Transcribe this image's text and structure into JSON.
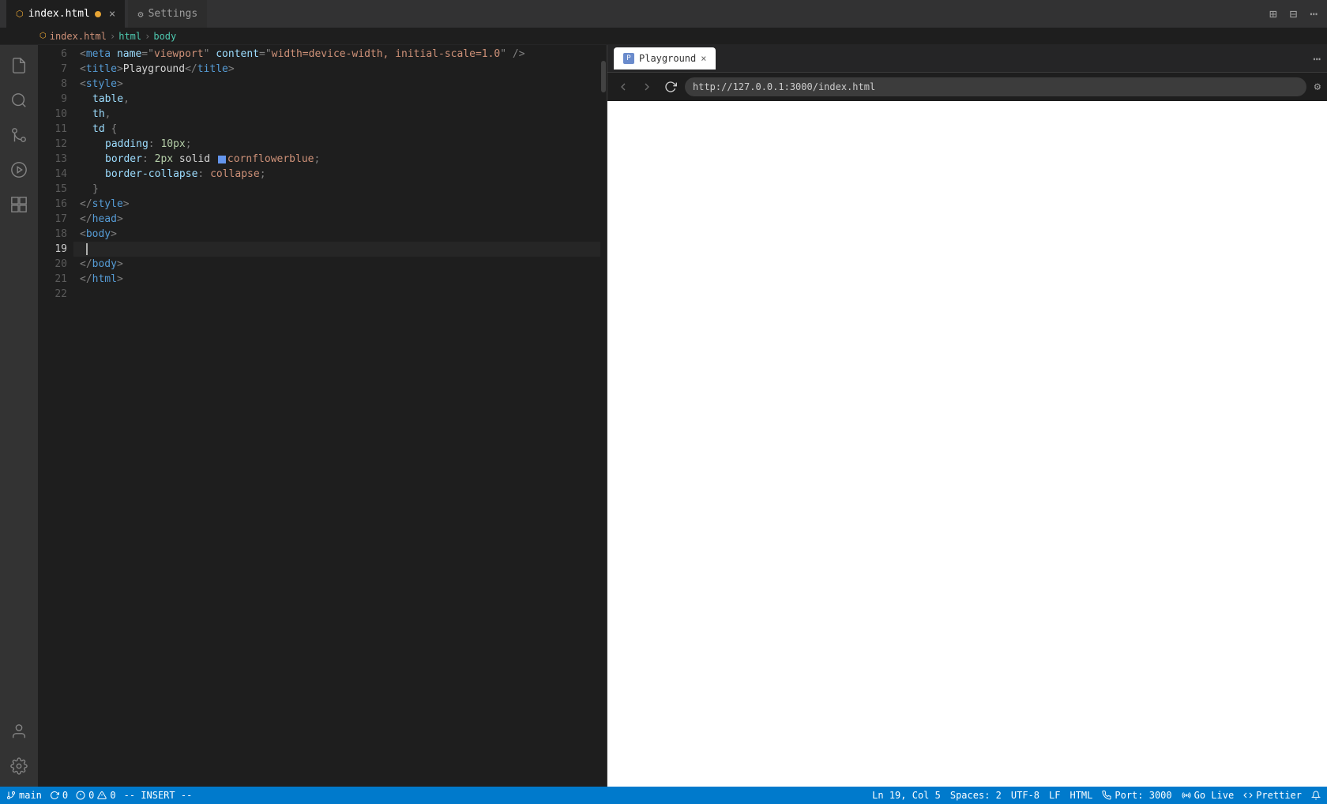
{
  "titleBar": {
    "tabs": [
      {
        "id": "index-html",
        "label": "index.html",
        "active": true,
        "modified": true
      },
      {
        "id": "settings",
        "label": "Settings",
        "active": false,
        "modified": false
      }
    ],
    "icons": [
      "split-editor-icon",
      "editor-layout-icon",
      "more-icon"
    ]
  },
  "breadcrumb": {
    "items": [
      "index.html",
      "html",
      "body"
    ]
  },
  "editor": {
    "lines": [
      {
        "num": 6,
        "content": "meta_viewport"
      },
      {
        "num": 7,
        "content": "title"
      },
      {
        "num": 8,
        "content": "style_open"
      },
      {
        "num": 9,
        "content": "table_comma"
      },
      {
        "num": 10,
        "content": "th_comma"
      },
      {
        "num": 11,
        "content": "td_brace"
      },
      {
        "num": 12,
        "content": "padding"
      },
      {
        "num": 13,
        "content": "border"
      },
      {
        "num": 14,
        "content": "border_collapse"
      },
      {
        "num": 15,
        "content": "brace_close"
      },
      {
        "num": 16,
        "content": "style_close"
      },
      {
        "num": 17,
        "content": "head_close"
      },
      {
        "num": 18,
        "content": "body_open"
      },
      {
        "num": 19,
        "content": "cursor_line",
        "active": true
      },
      {
        "num": 20,
        "content": "body_close"
      },
      {
        "num": 21,
        "content": "html_close"
      },
      {
        "num": 22,
        "content": "empty"
      }
    ],
    "activeLine": 19,
    "cursorPos": "Ln 19, Col 5",
    "spaces": "Spaces: 2",
    "encoding": "UTF-8",
    "lineEnding": "LF",
    "language": "HTML"
  },
  "browser": {
    "tab": {
      "label": "Playground",
      "icon": "playground-icon",
      "closable": true
    },
    "url": "http://127.0.0.1:3000/index.html",
    "backEnabled": false,
    "forwardEnabled": false
  },
  "statusBar": {
    "branch": "main",
    "sync": "0",
    "errors": "0",
    "warnings": "0",
    "mode": "-- INSERT --",
    "cursorPos": "Ln 19, Col 5",
    "spaces": "Spaces: 2",
    "encoding": "UTF-8",
    "lineEnding": "LF",
    "language": "HTML",
    "port": "Port: 3000",
    "goLive": "Go Live",
    "prettier": "Prettier"
  }
}
